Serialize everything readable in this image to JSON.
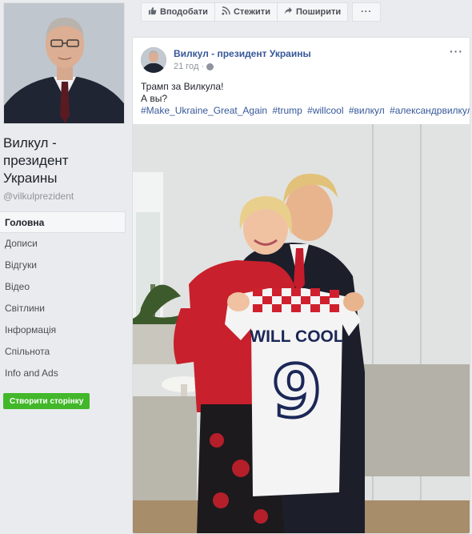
{
  "page": {
    "name": "Вилкул - президент Украины",
    "handle": "@vilkulprezident"
  },
  "nav": {
    "items": [
      {
        "label": "Головна",
        "active": true
      },
      {
        "label": "Дописи"
      },
      {
        "label": "Відгуки"
      },
      {
        "label": "Відео"
      },
      {
        "label": "Світлини"
      },
      {
        "label": "Інформація"
      },
      {
        "label": "Спільнота"
      },
      {
        "label": "Info and Ads"
      }
    ]
  },
  "create_page_label": "Створити сторінку",
  "actions": {
    "follow": "Вподобати",
    "subscribe": "Стежити",
    "share": "Поширити",
    "more": "···"
  },
  "post": {
    "author": "Вилкул - президент Украины",
    "time": "21 год",
    "menu": "···",
    "line1": "Трамп за Вилкула!",
    "line2": "А вы?",
    "hashtags": [
      "#Make_Ukraine_Great_Again",
      "#trump",
      "#willcool",
      "#вилкул",
      "#александрвилкул"
    ]
  },
  "jersey": {
    "name": "WILL COOL",
    "number": "9"
  },
  "colors": {
    "link": "#365899",
    "green_button": "#42b72a",
    "jersey_red": "#d0202e",
    "background": "#e9ebee"
  }
}
